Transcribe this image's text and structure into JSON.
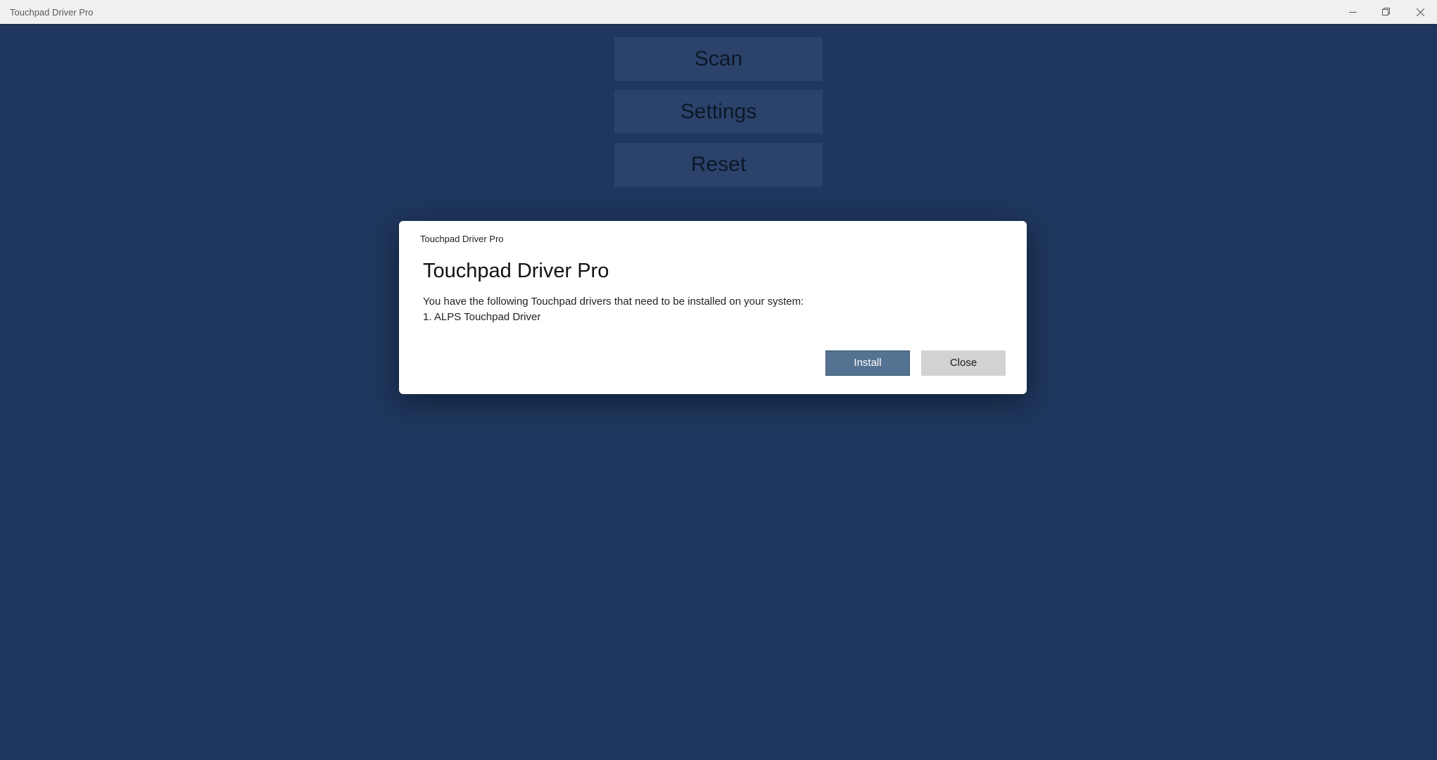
{
  "window": {
    "title": "Touchpad Driver Pro"
  },
  "main": {
    "buttons": {
      "scan": "Scan",
      "settings": "Settings",
      "reset": "Reset"
    }
  },
  "modal": {
    "small_title": "Touchpad Driver Pro",
    "heading": "Touchpad Driver Pro",
    "body_intro": "You have the following Touchpad drivers that need to be installed on your system:",
    "body_item": "1. ALPS Touchpad Driver",
    "install_label": "Install",
    "close_label": "Close"
  }
}
